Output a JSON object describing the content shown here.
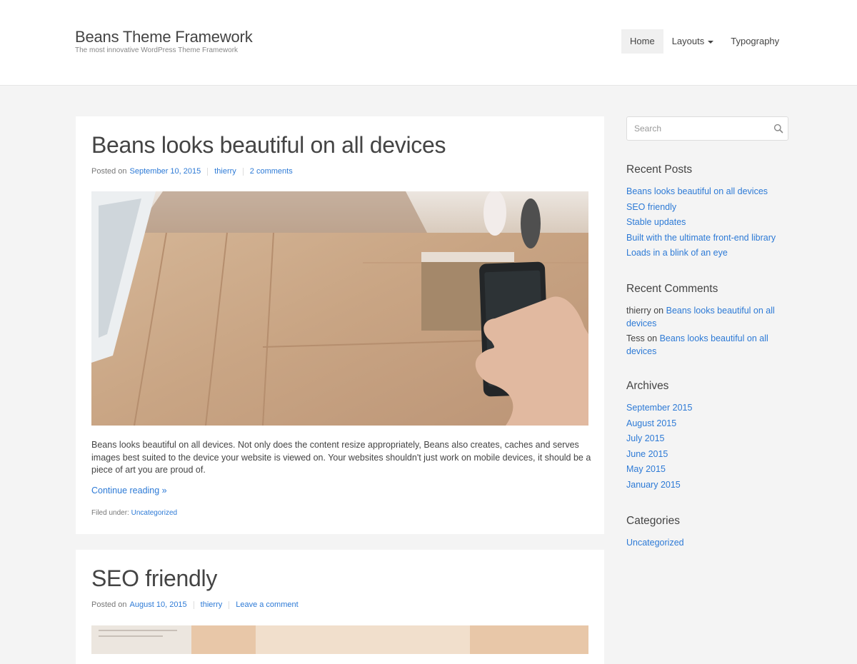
{
  "site": {
    "title": "Beans Theme Framework",
    "tagline": "The most innovative WordPress Theme Framework"
  },
  "nav": {
    "home": "Home",
    "layouts": "Layouts",
    "typography": "Typography"
  },
  "posts": [
    {
      "title": "Beans looks beautiful on all devices",
      "posted_on_label": "Posted on",
      "date": "September 10, 2015",
      "author": "thierry",
      "comments": "2 comments",
      "excerpt": "Beans looks beautiful on all devices. Not only does the content resize appropriately, Beans also creates, caches and serves images best suited to the device your website is viewed on. Your websites shouldn't just work on mobile devices, it should be a piece of art you are proud of.",
      "continue": "Continue reading »",
      "filed_label": "Filed under:",
      "category": "Uncategorized"
    },
    {
      "title": "SEO friendly",
      "posted_on_label": "Posted on",
      "date": "August 10, 2015",
      "author": "thierry",
      "comments": "Leave a comment"
    }
  ],
  "sidebar": {
    "search": {
      "placeholder": "Search"
    },
    "recent_posts": {
      "title": "Recent Posts",
      "items": [
        "Beans looks beautiful on all devices",
        "SEO friendly",
        "Stable updates",
        "Built with the ultimate front-end library",
        "Loads in a blink of an eye"
      ]
    },
    "recent_comments": {
      "title": "Recent Comments",
      "on_word": "on",
      "items": [
        {
          "author": "thierry",
          "post": "Beans looks beautiful on all devices"
        },
        {
          "author": "Tess",
          "post": "Beans looks beautiful on all devices"
        }
      ]
    },
    "archives": {
      "title": "Archives",
      "items": [
        "September 2015",
        "August 2015",
        "July 2015",
        "June 2015",
        "May 2015",
        "January 2015"
      ]
    },
    "categories": {
      "title": "Categories",
      "items": [
        "Uncategorized"
      ]
    }
  },
  "colors": {
    "link": "#2d7ad6",
    "text": "#444444",
    "background": "#f4f4f4"
  },
  "icons": {
    "search": "search-icon",
    "dropdown": "caret-down-icon"
  }
}
